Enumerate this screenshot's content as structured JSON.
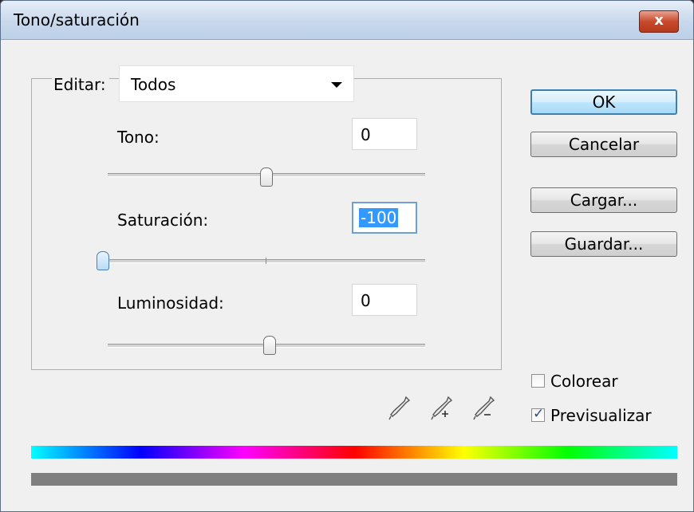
{
  "window": {
    "title": "Tono/saturación",
    "close_glyph": "x"
  },
  "edit": {
    "label": "Editar:",
    "selected": "Todos"
  },
  "sliders": {
    "hue": {
      "label": "Tono:",
      "value": "0"
    },
    "saturation": {
      "label": "Saturación:",
      "value": "-100"
    },
    "lightness": {
      "label": "Luminosidad:",
      "value": "0"
    }
  },
  "buttons": {
    "ok": "OK",
    "cancel": "Cancelar",
    "load": "Cargar...",
    "save": "Guardar..."
  },
  "checkboxes": {
    "colorize": {
      "label": "Colorear",
      "checked": false
    },
    "preview": {
      "label": "Previsualizar",
      "checked": true,
      "mark": "✓"
    }
  },
  "icons": {
    "eyedropper": "eyedropper-icon",
    "eyedropper_add": "eyedropper-add-icon",
    "eyedropper_subtract": "eyedropper-subtract-icon"
  }
}
